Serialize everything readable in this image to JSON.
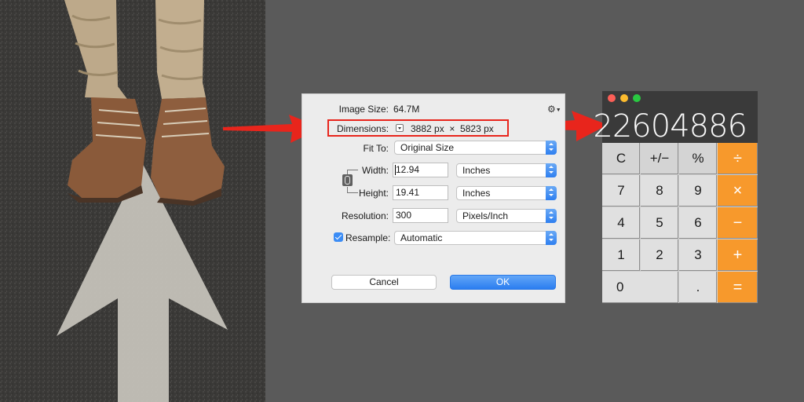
{
  "dialog": {
    "image_size_label": "Image Size:",
    "image_size_value": "64.7M",
    "gear_icon": "gear-icon",
    "dimensions_label": "Dimensions:",
    "dimensions_value": "3882 px  ×  5823 px",
    "fit_to_label": "Fit To:",
    "fit_to_value": "Original Size",
    "width_label": "Width:",
    "width_value": "12.94",
    "width_unit": "Inches",
    "height_label": "Height:",
    "height_value": "19.41",
    "height_unit": "Inches",
    "resolution_label": "Resolution:",
    "resolution_value": "300",
    "resolution_unit": "Pixels/Inch",
    "resample_label": "Resample:",
    "resample_checked": true,
    "resample_value": "Automatic",
    "cancel_label": "Cancel",
    "ok_label": "OK"
  },
  "calculator": {
    "display": "22604886",
    "keys": [
      [
        "C",
        "+/−",
        "%",
        "÷"
      ],
      [
        "7",
        "8",
        "9",
        "×"
      ],
      [
        "4",
        "5",
        "6",
        "−"
      ],
      [
        "1",
        "2",
        "3",
        "+"
      ],
      [
        "0",
        ".",
        "="
      ]
    ]
  },
  "colors": {
    "background": "#5a5a5a",
    "callout_red": "#e8251c",
    "accent_blue": "#2e7ff0",
    "operator_orange": "#f7992c",
    "calc_display": "#3a3a3a"
  }
}
